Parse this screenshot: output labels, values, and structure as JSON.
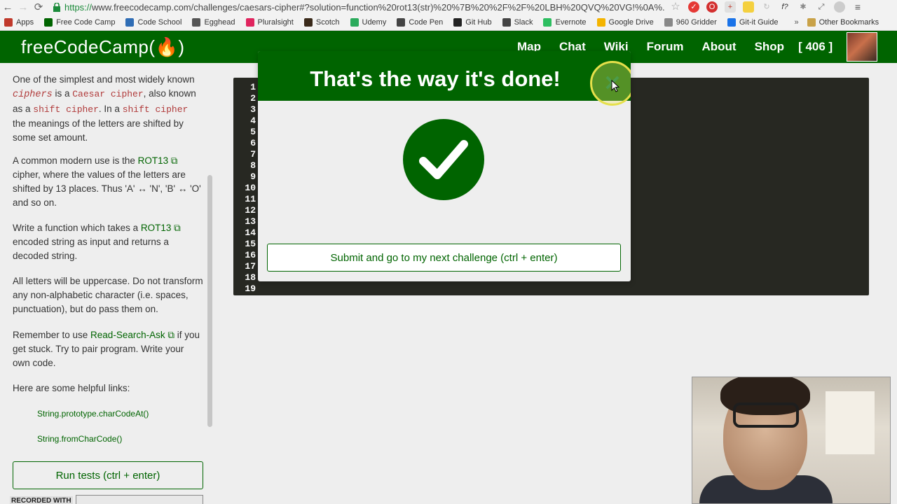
{
  "browser": {
    "url": "https://www.freecodecamp.com/challenges/caesars-cipher#?solution=function%20rot13(str)%20%7B%20%2F%2F%20LBH%20QVQ%20VG!%0A%...",
    "url_secure_prefix": "https://",
    "url_rest": "www.freecodecamp.com/challenges/caesars-cipher#?solution=function%20rot13(str)%20%7B%20%2F%2F%20LBH%20QVQ%20VG!%0A%...",
    "back_glyph": "←",
    "forward_glyph": "→",
    "reload_glyph": "⟳"
  },
  "bookmarks": [
    {
      "label": "Apps",
      "icon": "apps-icon",
      "color": "#c0392b"
    },
    {
      "label": "Free Code Camp",
      "icon": "fcc-icon",
      "color": "#006400"
    },
    {
      "label": "Code School",
      "icon": "code-icon",
      "color": "#2f6db5"
    },
    {
      "label": "Egghead",
      "icon": "egghead-icon",
      "color": "#555555"
    },
    {
      "label": "Pluralsight",
      "icon": "pluralsight-icon",
      "color": "#e0245e"
    },
    {
      "label": "Scotch",
      "icon": "scotch-icon",
      "color": "#3a2a1a"
    },
    {
      "label": "Udemy",
      "icon": "udemy-icon",
      "color": "#2bab5c"
    },
    {
      "label": "Code Pen",
      "icon": "codepen-icon",
      "color": "#444444"
    },
    {
      "label": "Git Hub",
      "icon": "github-icon",
      "color": "#222222"
    },
    {
      "label": "Slack",
      "icon": "slack-icon",
      "color": "#444444"
    },
    {
      "label": "Evernote",
      "icon": "evernote-icon",
      "color": "#2dbe60"
    },
    {
      "label": "Google Drive",
      "icon": "drive-icon",
      "color": "#f4b400"
    },
    {
      "label": "960 Gridder",
      "icon": "page-icon",
      "color": "#888888"
    },
    {
      "label": "Git-it Guide",
      "icon": "git-icon",
      "color": "#1a73e8"
    }
  ],
  "bookmarks_more": "»",
  "other_bookmarks": "Other Bookmarks",
  "header": {
    "logo": "freeCodeCamp(🔥)",
    "links": [
      "Map",
      "Chat",
      "Wiki",
      "Forum",
      "About",
      "Shop"
    ],
    "points": "[ 406 ]"
  },
  "instructions": {
    "p1_a": "One of the simplest and most widely known ",
    "p1_ciphers": "ciphers",
    "p1_b": " is a ",
    "p1_caesar": "Caesar cipher",
    "p1_c": ", also known as a ",
    "p1_shift1": "shift cipher",
    "p1_d": ". In a ",
    "p1_shift2": "shift cipher",
    "p1_e": " the meanings of the letters are shifted by some set amount.",
    "p2_a": "A common modern use is the ",
    "p2_link": "ROT13",
    "p2_b": " cipher, where the values of the letters are shifted by 13 places. Thus 'A' ↔ 'N', 'B' ↔ 'O' and so on.",
    "p3_a": "Write a function which takes a ",
    "p3_link": "ROT13",
    "p3_b": " encoded string as input and returns a decoded string.",
    "p4": "All letters will be uppercase. Do not transform any non-alphabetic character (i.e. spaces, punctuation), but do pass them on.",
    "p5_a": "Remember to use ",
    "p5_link": "Read-Search-Ask",
    "p5_b": " if you get stuck. Try to pair program. Write your own code.",
    "p6": "Here are some helpful links:",
    "help_links": [
      "String.prototype.charCodeAt()",
      "String.fromCharCode()"
    ],
    "run_tests": "Run tests (ctrl + enter)",
    "recorded_with": "RECORDED WITH"
  },
  "editor": {
    "line_numbers": [
      "1",
      "2",
      "3",
      "4",
      "5",
      "6",
      "7",
      "8",
      "9",
      "10",
      "11",
      "12",
      "13",
      "14",
      "15",
      "16",
      "17",
      "18",
      "19"
    ]
  },
  "modal": {
    "title": "That's the way it's done!",
    "close_glyph": "✕",
    "submit": "Submit and go to my next challenge (ctrl + enter)"
  },
  "colors": {
    "brand_green": "#006400",
    "panel_bg": "#eeeeee",
    "editor_bg": "#272822",
    "cursor_highlight": "#e6e04a"
  }
}
